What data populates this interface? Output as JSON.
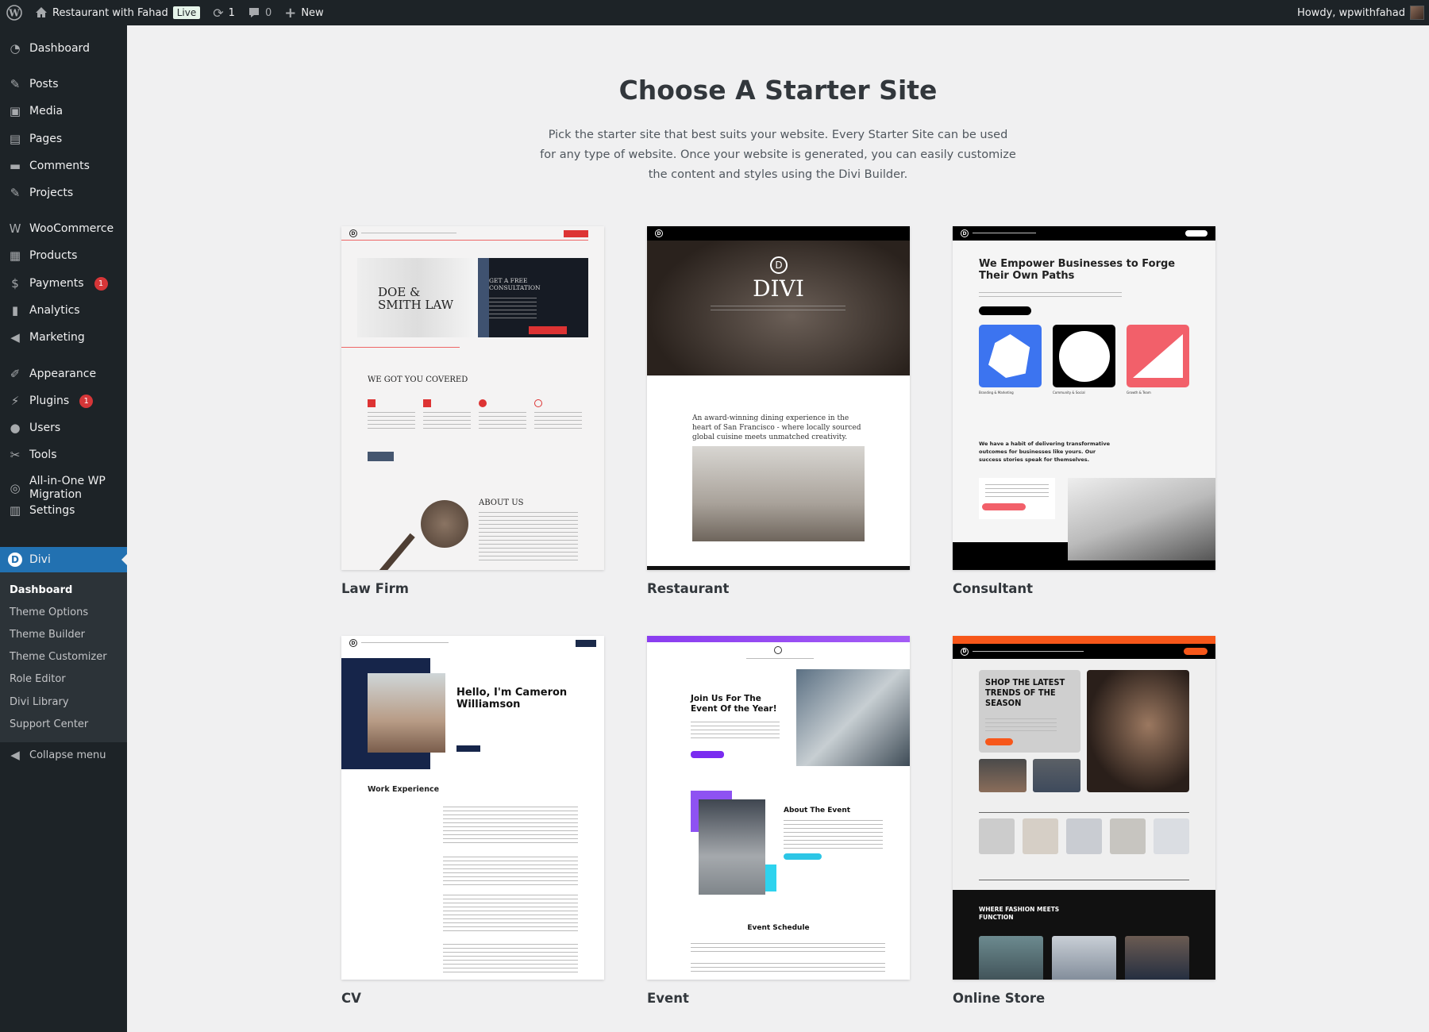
{
  "adminbar": {
    "site_name": "Restaurant with Fahad",
    "live_badge": "Live",
    "updates_count": "1",
    "comments_count": "0",
    "new_label": "New",
    "howdy": "Howdy, wpwithfahad"
  },
  "sidebar": {
    "items": [
      {
        "label": "Dashboard",
        "icon": "dashboard-icon"
      },
      {
        "label": "Posts",
        "icon": "pin-icon"
      },
      {
        "label": "Media",
        "icon": "media-icon"
      },
      {
        "label": "Pages",
        "icon": "pages-icon"
      },
      {
        "label": "Comments",
        "icon": "comment-icon"
      },
      {
        "label": "Projects",
        "icon": "pin-icon"
      },
      {
        "label": "WooCommerce",
        "icon": "woo-icon"
      },
      {
        "label": "Products",
        "icon": "archive-icon"
      },
      {
        "label": "Payments",
        "icon": "dollar-icon",
        "badge": "1"
      },
      {
        "label": "Analytics",
        "icon": "bar-chart-icon"
      },
      {
        "label": "Marketing",
        "icon": "megaphone-icon"
      },
      {
        "label": "Appearance",
        "icon": "brush-icon"
      },
      {
        "label": "Plugins",
        "icon": "plug-icon",
        "badge": "1"
      },
      {
        "label": "Users",
        "icon": "user-icon"
      },
      {
        "label": "Tools",
        "icon": "wrench-icon"
      },
      {
        "label": "All-in-One WP Migration",
        "icon": "migration-icon"
      },
      {
        "label": "Settings",
        "icon": "settings-icon"
      },
      {
        "label": "Divi",
        "icon": "divi-icon"
      }
    ],
    "submenu": [
      "Dashboard",
      "Theme Options",
      "Theme Builder",
      "Theme Customizer",
      "Role Editor",
      "Divi Library",
      "Support Center"
    ],
    "collapse": "Collapse menu"
  },
  "main": {
    "title": "Choose A Starter Site",
    "description": "Pick the starter site that best suits your website. Every Starter Site can be used for any type of website. Once your website is generated, you can easily customize the content and styles using the Divi Builder.",
    "sites": [
      {
        "name": "Law Firm",
        "hero": "DOE & SMITH LAW",
        "cta": "GET A FREE CONSULTATION",
        "section": "WE GOT YOU COVERED",
        "about": "ABOUT US"
      },
      {
        "name": "Restaurant",
        "hero": "DIVI",
        "tagline": "An award-winning dining experience in the heart of San Francisco - where locally sourced global cuisine meets unmatched creativity."
      },
      {
        "name": "Consultant",
        "hero": "We Empower Businesses to Forge Their Own Paths",
        "tiles": [
          "Branding & Marketing",
          "Community & Social",
          "Growth & Team"
        ],
        "about": "We have a habit of delivering transformative outcomes for businesses like yours. Our success stories speak for themselves."
      },
      {
        "name": "CV",
        "hero": "Hello, I'm Cameron Williamson",
        "section": "Work Experience"
      },
      {
        "name": "Event",
        "hero": "Join Us For The Event Of the Year!",
        "about": "About The Event",
        "schedule": "Event Schedule"
      },
      {
        "name": "Online Store",
        "hero": "SHOP THE LATEST TRENDS OF THE SEASON",
        "section": "WHERE FASHION MEETS FUNCTION"
      }
    ]
  },
  "colors": {
    "accent": "#2271b1",
    "adminbar": "#1d2327",
    "badge": "#d63638"
  }
}
